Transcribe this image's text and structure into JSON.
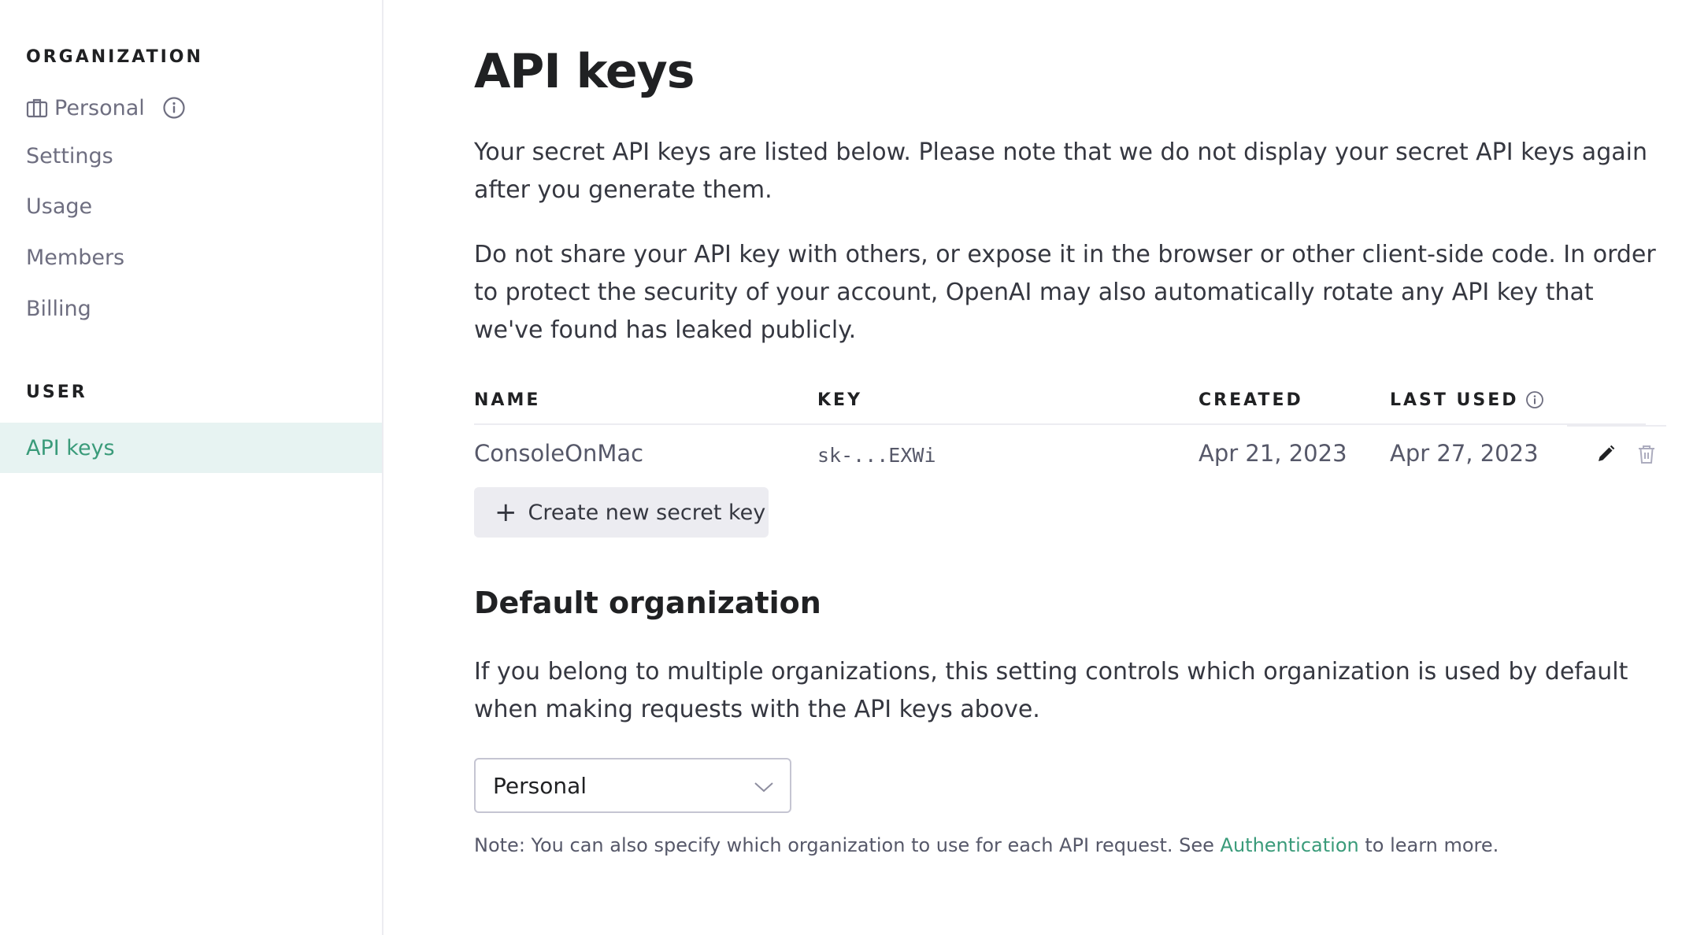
{
  "sidebar": {
    "org_heading": "ORGANIZATION",
    "org_name": "Personal",
    "org_icon": "briefcase-icon",
    "org_info_icon": "info-icon",
    "items": [
      {
        "label": "Settings"
      },
      {
        "label": "Usage"
      },
      {
        "label": "Members"
      },
      {
        "label": "Billing"
      }
    ],
    "user_heading": "USER",
    "user_items": [
      {
        "label": "API keys",
        "active": true
      }
    ]
  },
  "main": {
    "title": "API keys",
    "intro_1": "Your secret API keys are listed below. Please note that we do not display your secret API keys again after you generate them.",
    "intro_2": "Do not share your API key with others, or expose it in the browser or other client-side code. In order to protect the security of your account, OpenAI may also automatically rotate any API key that we've found has leaked publicly.",
    "table": {
      "columns": [
        "NAME",
        "KEY",
        "CREATED",
        "LAST USED"
      ],
      "rows": [
        {
          "name": "ConsoleOnMac",
          "key": "sk-...EXWi",
          "created": "Apr 21, 2023",
          "last_used": "Apr 27, 2023",
          "actions": [
            "edit-icon",
            "trash-icon"
          ]
        }
      ]
    },
    "create_button": {
      "icon": "+",
      "label": "Create new secret key"
    },
    "default_org": {
      "heading": "Default organization",
      "description": "If you belong to multiple organizations, this setting controls which organization is used by default when making requests with the API keys above.",
      "select_value": "Personal",
      "note_prefix": "Note: You can also specify which organization to use for each API request. See ",
      "note_link": "Authentication",
      "note_suffix": " to learn more."
    }
  },
  "colors": {
    "accent": "#3a9b7a",
    "active_bg": "#e7f3f2",
    "button_bg": "#ececf1",
    "border": "#ececf1"
  }
}
